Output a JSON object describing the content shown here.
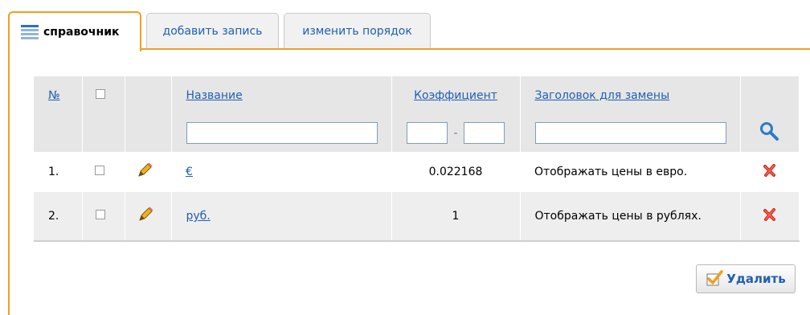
{
  "tabs": [
    {
      "label": "справочник",
      "active": true,
      "icon": "list-book-icon"
    },
    {
      "label": "добавить запись",
      "active": false
    },
    {
      "label": "изменить порядок",
      "active": false
    }
  ],
  "table": {
    "headers": {
      "num": "№",
      "name": "Название",
      "coef": "Коэффициент",
      "title": "Заголовок для замены"
    },
    "filter": {
      "name_value": "",
      "coef_from": "",
      "coef_separator": "-",
      "coef_to": "",
      "title_value": ""
    },
    "rows": [
      {
        "num": "1.",
        "name": "€",
        "coef": "0.022168",
        "title": "Отображать цены в евро."
      },
      {
        "num": "2.",
        "name": "руб.",
        "coef": "1",
        "title": "Отображать цены в рублях."
      }
    ]
  },
  "actions": {
    "delete_label": "Удалить"
  },
  "colors": {
    "accent_orange": "#f0a01e",
    "link_blue": "#1f5fb4",
    "delete_red": "#d42a1c",
    "header_gray": "#e6e6e6"
  }
}
